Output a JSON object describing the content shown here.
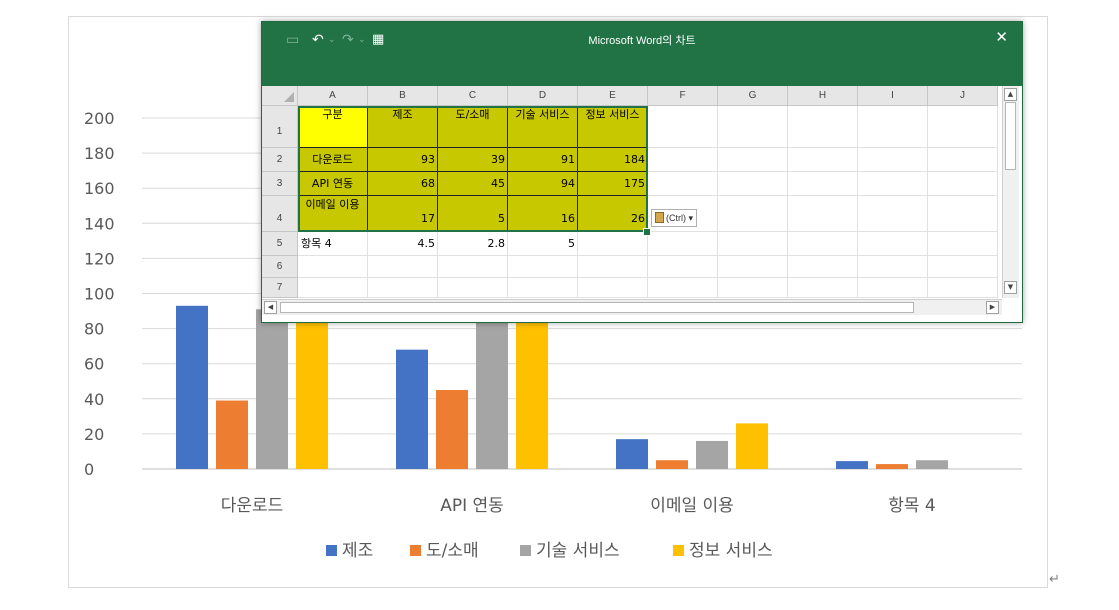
{
  "chart_data": {
    "type": "bar",
    "categories": [
      "다운로드",
      "API 연동",
      "이메일 이용",
      "항목 4"
    ],
    "series": [
      {
        "name": "제조",
        "values": [
          93,
          68,
          17,
          4.5
        ],
        "color": "#4472c4"
      },
      {
        "name": "도/소매",
        "values": [
          39,
          45,
          5,
          2.8
        ],
        "color": "#ed7d31"
      },
      {
        "name": "기술 서비스",
        "values": [
          91,
          94,
          16,
          5
        ],
        "color": "#a5a5a5"
      },
      {
        "name": "정보 서비스",
        "values": [
          184,
          175,
          26,
          null
        ],
        "color": "#ffc000"
      }
    ],
    "ylim": [
      0,
      200
    ],
    "yticks": [
      "0",
      "20",
      "40",
      "60",
      "80",
      "100",
      "120",
      "140",
      "160",
      "180",
      "200"
    ],
    "grid": true,
    "legend_position": "bottom"
  },
  "excel_window": {
    "title": "Microsoft Word의 차트",
    "close_symbol": "✕",
    "quick_access": {
      "save_icon": "save-icon",
      "undo_icon": "undo-icon",
      "redo_icon": "redo-icon",
      "edit_data_icon": "edit-data-icon"
    },
    "columns": [
      "A",
      "B",
      "C",
      "D",
      "E",
      "F",
      "G",
      "H",
      "I",
      "J"
    ],
    "rows": [
      "1",
      "2",
      "3",
      "4",
      "5",
      "6",
      "7"
    ],
    "cells": [
      [
        "구분",
        "제조",
        "도/소매",
        "기술 서비스",
        "정보 서비스"
      ],
      [
        "다운로드",
        "93",
        "39",
        "91",
        "184"
      ],
      [
        "API 연동",
        "68",
        "45",
        "94",
        "175"
      ],
      [
        "이메일 이용",
        "17",
        "5",
        "16",
        "26"
      ],
      [
        "항목 4",
        "4.5",
        "2.8",
        "5",
        ""
      ]
    ],
    "paste_options_label": "(Ctrl) ▾"
  },
  "colors": {
    "excel_green": "#217346",
    "selection_fill": "#c8c800",
    "header_fill": "#ffff00"
  }
}
